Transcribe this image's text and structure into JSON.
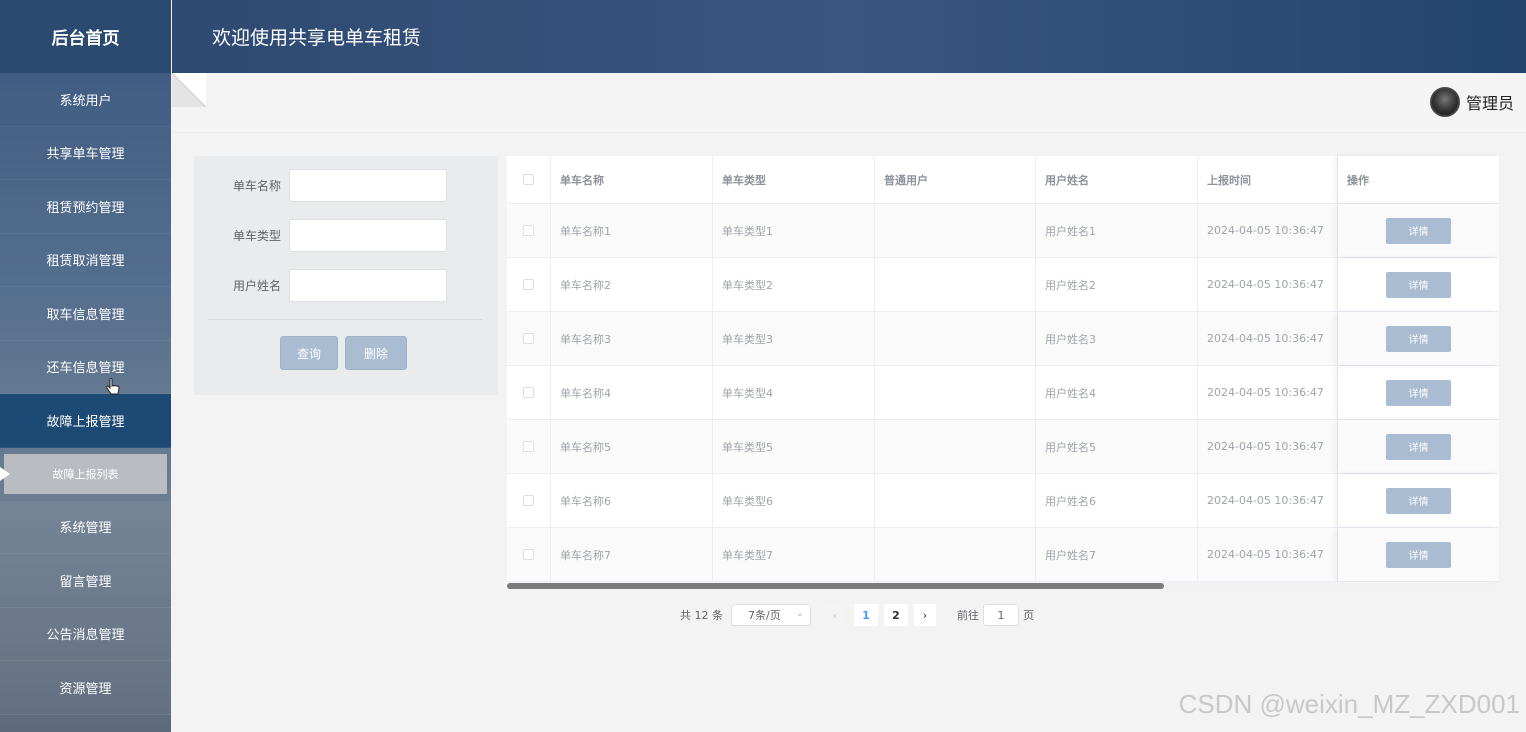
{
  "sidebar": {
    "brand": "后台首页",
    "items": [
      {
        "label": "系统用户"
      },
      {
        "label": "共享单车管理"
      },
      {
        "label": "租赁预约管理"
      },
      {
        "label": "租赁取消管理"
      },
      {
        "label": "取车信息管理"
      },
      {
        "label": "还车信息管理"
      },
      {
        "label": "故障上报管理"
      },
      {
        "label": "故障上报列表"
      },
      {
        "label": "系统管理"
      },
      {
        "label": "留言管理"
      },
      {
        "label": "公告消息管理"
      },
      {
        "label": "资源管理"
      }
    ]
  },
  "header": {
    "title": "欢迎使用共享电单车租赁"
  },
  "topbar": {
    "user_name": "管理员"
  },
  "search": {
    "fields": [
      {
        "label": "单车名称",
        "value": ""
      },
      {
        "label": "单车类型",
        "value": ""
      },
      {
        "label": "用户姓名",
        "value": ""
      }
    ],
    "query_label": "查询",
    "delete_label": "删除"
  },
  "table": {
    "columns": [
      "单车名称",
      "单车类型",
      "普通用户",
      "用户姓名",
      "上报时间",
      "操作"
    ],
    "detail_label": "详情",
    "rows": [
      {
        "name": "单车名称1",
        "type": "单车类型1",
        "user": "",
        "username": "用户姓名1",
        "time": "2024-04-05 10:36:47"
      },
      {
        "name": "单车名称2",
        "type": "单车类型2",
        "user": "",
        "username": "用户姓名2",
        "time": "2024-04-05 10:36:47"
      },
      {
        "name": "单车名称3",
        "type": "单车类型3",
        "user": "",
        "username": "用户姓名3",
        "time": "2024-04-05 10:36:47"
      },
      {
        "name": "单车名称4",
        "type": "单车类型4",
        "user": "",
        "username": "用户姓名4",
        "time": "2024-04-05 10:36:47"
      },
      {
        "name": "单车名称5",
        "type": "单车类型5",
        "user": "",
        "username": "用户姓名5",
        "time": "2024-04-05 10:36:47"
      },
      {
        "name": "单车名称6",
        "type": "单车类型6",
        "user": "",
        "username": "用户姓名6",
        "time": "2024-04-05 10:36:47"
      },
      {
        "name": "单车名称7",
        "type": "单车类型7",
        "user": "",
        "username": "用户姓名7",
        "time": "2024-04-05 10:36:47"
      }
    ]
  },
  "pagination": {
    "total": "共 12 条",
    "page_size": "7条/页",
    "pages": [
      "1",
      "2"
    ],
    "current": "1",
    "goto_prefix": "前往",
    "goto_value": "1",
    "goto_suffix": "页"
  },
  "watermark": "CSDN @weixin_MZ_ZXD001",
  "colors": {
    "header": "#2e4a72",
    "active_menu": "#1c4a74",
    "button": "#a9bcd1"
  }
}
